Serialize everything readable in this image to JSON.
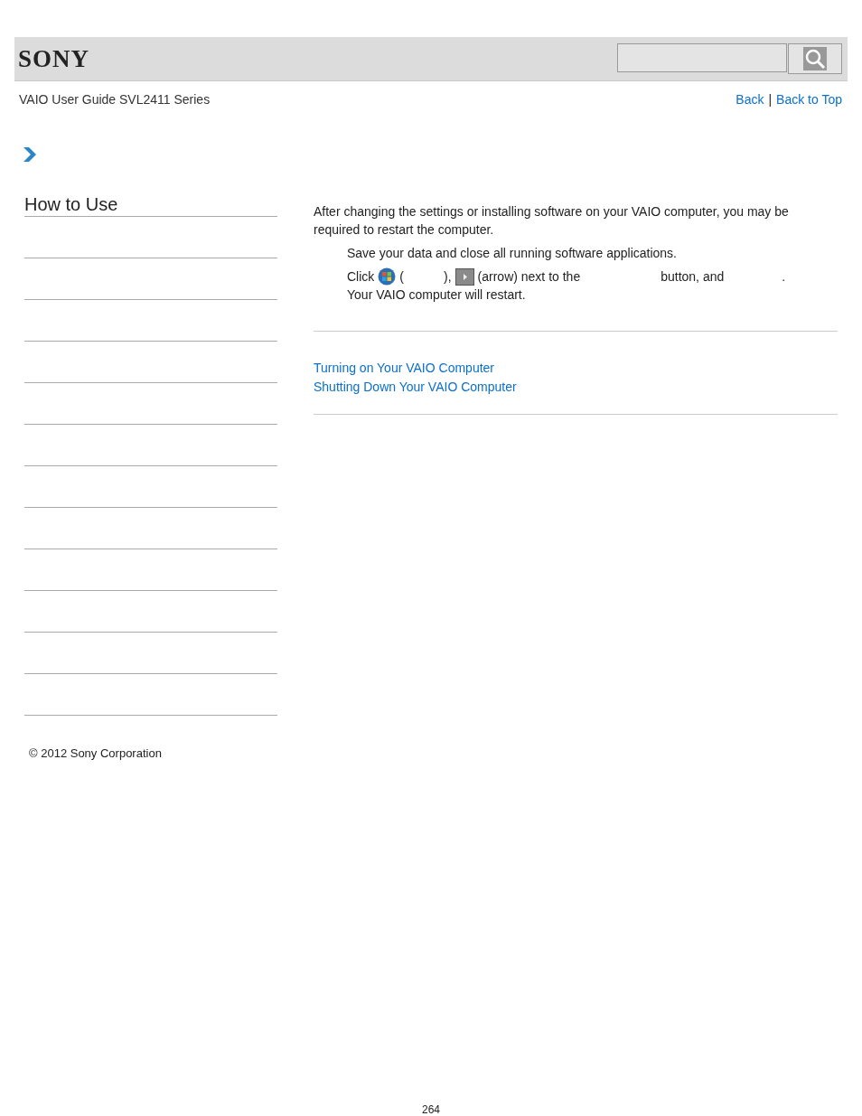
{
  "header": {
    "logo": "SONY"
  },
  "subheader": {
    "title": "VAIO User Guide SVL2411 Series",
    "links": [
      "Back",
      "Back to Top"
    ],
    "separator": "|"
  },
  "sidebar": {
    "heading": "How to Use"
  },
  "content": {
    "intro": "After changing the settings or installing software on your VAIO computer, you may be required to restart the computer.",
    "steps": [
      {
        "segments": [
          {
            "kind": "text",
            "text": "Save your data and close all running software applications."
          }
        ]
      },
      {
        "segments": [
          {
            "kind": "text",
            "text": "Click"
          },
          {
            "kind": "start-orb"
          },
          {
            "kind": "text",
            "text": "("
          },
          {
            "kind": "blank-short"
          },
          {
            "kind": "text",
            "text": "),"
          },
          {
            "kind": "arrow-button"
          },
          {
            "kind": "text",
            "text": "(arrow) next to the"
          },
          {
            "kind": "blank-long"
          },
          {
            "kind": "text",
            "text": "button, and"
          },
          {
            "kind": "blank-medium"
          },
          {
            "kind": "text",
            "text": "."
          }
        ],
        "result": "Your VAIO computer will restart."
      }
    ],
    "related": [
      "Turning on Your VAIO Computer",
      "Shutting Down Your VAIO Computer"
    ]
  },
  "footer": {
    "copyright": "© 2012 Sony Corporation",
    "page": "264"
  }
}
